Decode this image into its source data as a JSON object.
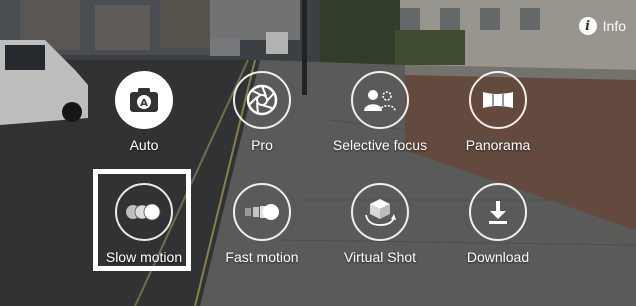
{
  "info": {
    "label": "Info",
    "icon": "info-icon"
  },
  "modes": [
    {
      "label": "Auto",
      "icon": "camera-auto-icon",
      "selected": false
    },
    {
      "label": "Pro",
      "icon": "aperture-icon",
      "selected": false
    },
    {
      "label": "Selective focus",
      "icon": "selective-focus-icon",
      "selected": false
    },
    {
      "label": "Panorama",
      "icon": "panorama-icon",
      "selected": false
    },
    {
      "label": "Slow motion",
      "icon": "slow-motion-icon",
      "selected": true
    },
    {
      "label": "Fast motion",
      "icon": "fast-motion-icon",
      "selected": false
    },
    {
      "label": "Virtual Shot",
      "icon": "virtual-shot-icon",
      "selected": false
    },
    {
      "label": "Download",
      "icon": "download-icon",
      "selected": false
    }
  ],
  "colors": {
    "overlay_text": "#ffffff",
    "highlight": "#ffffff"
  }
}
